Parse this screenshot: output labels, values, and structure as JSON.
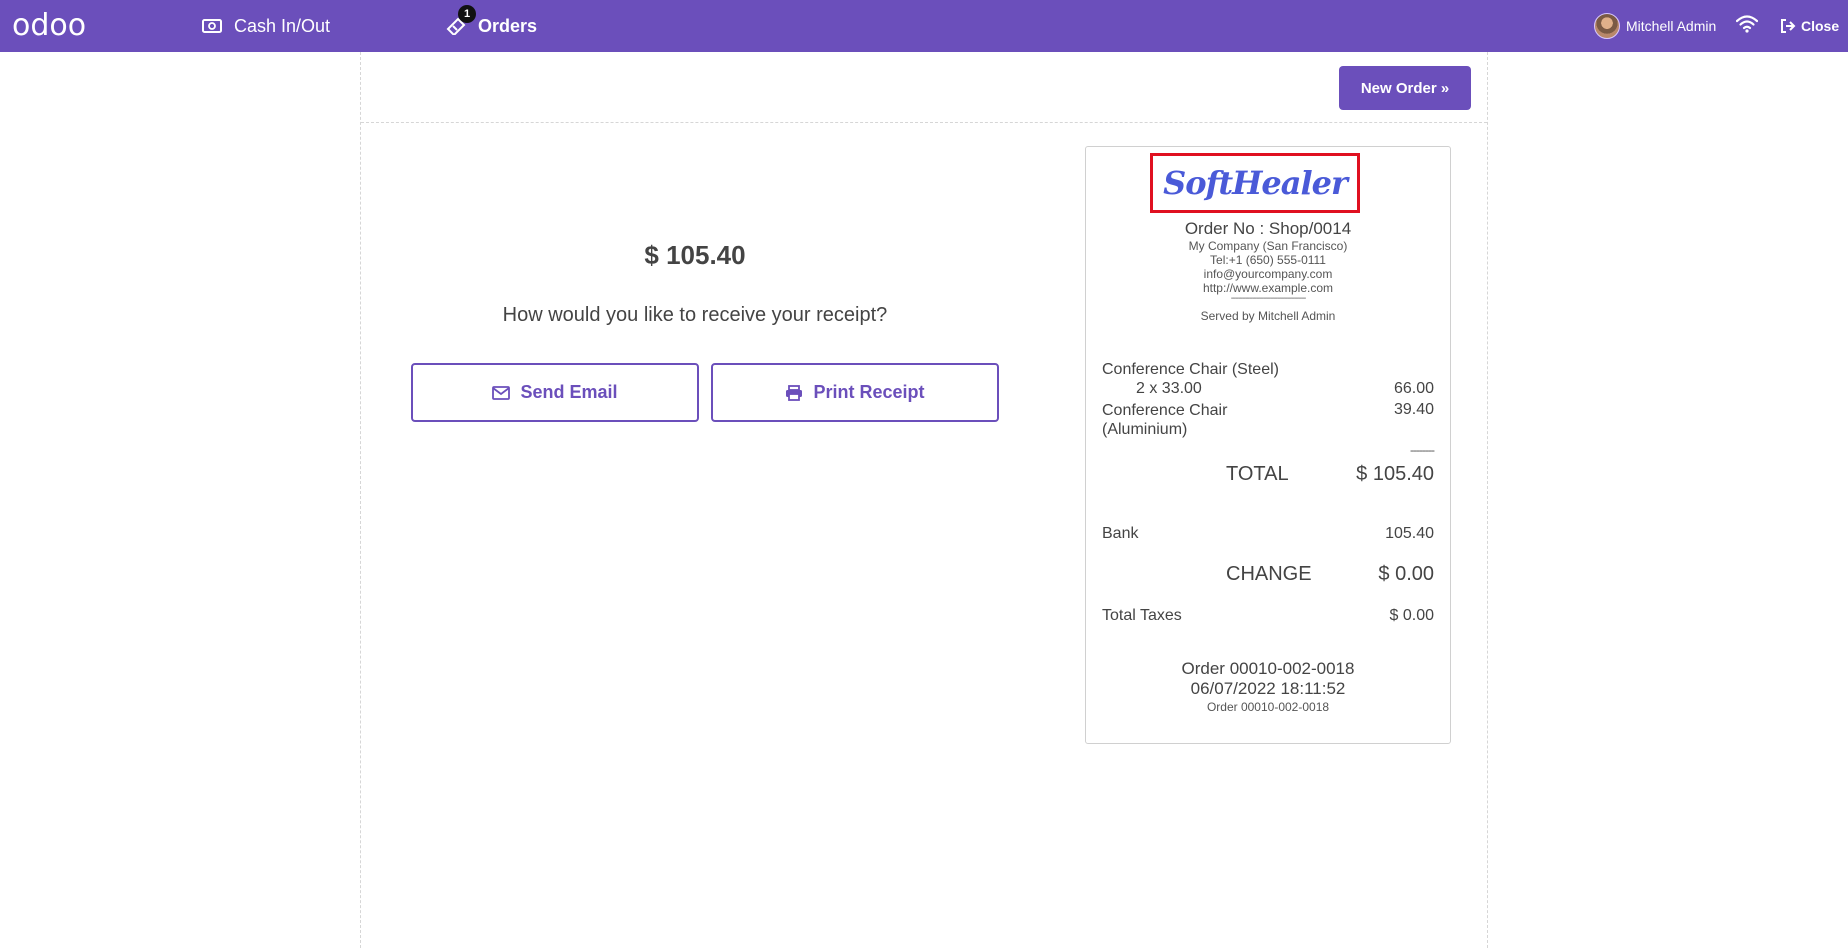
{
  "topbar": {
    "logo": "odoo",
    "cash_label": "Cash In/Out",
    "orders_label": "Orders",
    "orders_badge": "1",
    "user_name": "Mitchell Admin",
    "close_label": "Close"
  },
  "actions": {
    "new_order_label": "New Order »"
  },
  "payment": {
    "amount": "$ 105.40",
    "question": "How would you like to receive your receipt?",
    "send_email_label": "Send Email",
    "print_receipt_label": "Print Receipt"
  },
  "receipt": {
    "logo_text": "SoftHealer",
    "order_no": "Order No : Shop/0014",
    "company": "My Company (San Francisco)",
    "tel": "Tel:+1 (650) 555-0111",
    "email": "info@yourcompany.com",
    "website": "http://www.example.com",
    "separator": "--------------------------------",
    "served_by": "Served by Mitchell Admin",
    "lines": [
      {
        "name": "Conference Chair (Steel)",
        "qty_text": "2 x 33.00",
        "amount": "66.00"
      },
      {
        "name": "Conference Chair (Aluminium)",
        "qty_text": "",
        "amount": "39.40"
      }
    ],
    "total_separator": "--------",
    "total_label": "TOTAL",
    "total_value": "$ 105.40",
    "payment_method": "Bank",
    "payment_amount": "105.40",
    "change_label": "CHANGE",
    "change_value": "$ 0.00",
    "taxes_label": "Total Taxes",
    "taxes_value": "$ 0.00",
    "footer_order": "Order 00010-002-0018",
    "footer_datetime": "06/07/2022 18:11:52",
    "footer_ref": "Order 00010-002-0018"
  },
  "colors": {
    "brand": "#6b4fbb",
    "highlight": "#e01020",
    "logo_blue": "#4a5ad8"
  }
}
